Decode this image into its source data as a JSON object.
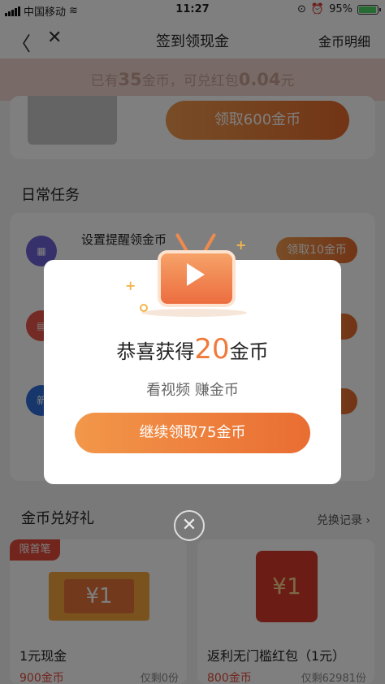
{
  "status_bar": {
    "carrier": "中国移动",
    "time": "11:27",
    "battery": "95%",
    "battery_level": 0.95
  },
  "nav": {
    "title": "签到领现金",
    "right_link": "金币明细"
  },
  "banner": {
    "prefix": "已有",
    "coins": "35",
    "middle": "金币，可兑红包",
    "amount": "0.04",
    "suffix": "元"
  },
  "top_card": {
    "button": "领取600金币"
  },
  "daily_tasks": {
    "title": "日常任务",
    "items": [
      {
        "label": "设置提醒领金币",
        "button": "领取10金币",
        "icon": "calendar-icon"
      },
      {
        "label": "",
        "button": "",
        "icon": "news-icon"
      },
      {
        "label": "",
        "button": "",
        "icon": "new-badge-icon",
        "badge_text": "新"
      }
    ]
  },
  "gifts": {
    "title": "金币兑好礼",
    "record_link": "兑换记录",
    "items": [
      {
        "tag": "限首笔",
        "coupon": "¥1",
        "name": "1元现金",
        "price": "900金币",
        "stock": "仅剩0份"
      },
      {
        "coupon": "¥1",
        "name": "返利无门槛红包（1元）",
        "price": "800金币",
        "stock": "仅剩62981份"
      }
    ]
  },
  "modal": {
    "congrats_prefix": "恭喜获得",
    "coins": "20",
    "congrats_suffix": "金币",
    "subtitle": "看视频 赚金币",
    "cta": "继续领取75金币"
  },
  "colors": {
    "accent_orange": "#ef7a3a",
    "overlay": "rgba(0,0,0,0.5)",
    "red": "#e24a3b"
  }
}
